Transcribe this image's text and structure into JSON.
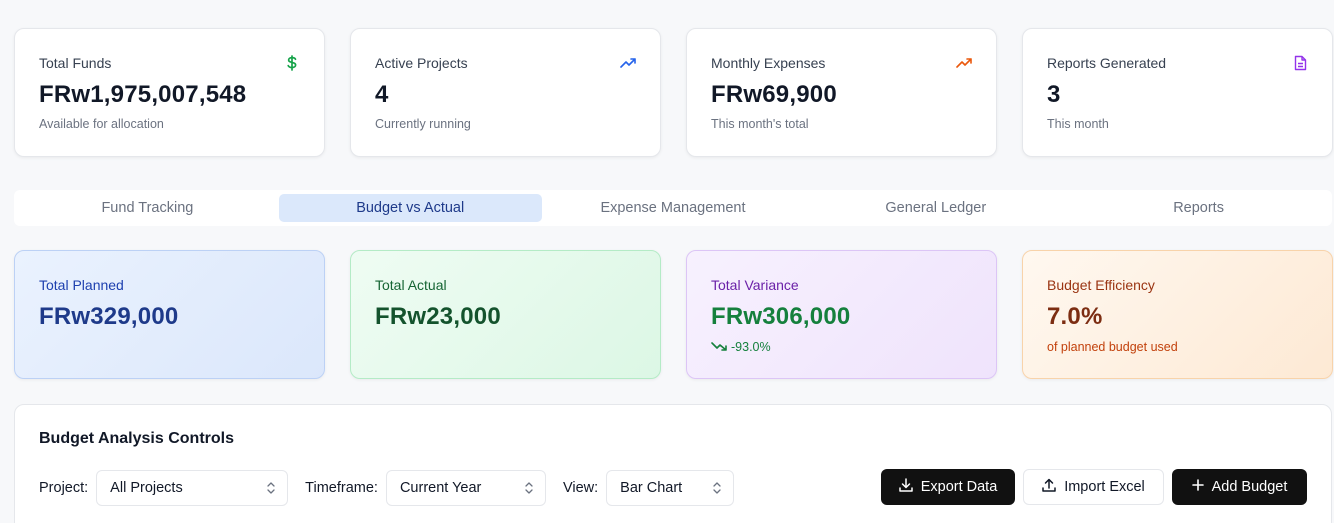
{
  "stats": [
    {
      "title": "Total Funds",
      "value": "FRw1,975,007,548",
      "sub": "Available for allocation",
      "icon": "dollar-icon",
      "icon_color": "#16a34a"
    },
    {
      "title": "Active Projects",
      "value": "4",
      "sub": "Currently running",
      "icon": "trending-up-icon",
      "icon_color": "#2563eb"
    },
    {
      "title": "Monthly Expenses",
      "value": "FRw69,900",
      "sub": "This month's total",
      "icon": "trending-up-icon",
      "icon_color": "#ea580c"
    },
    {
      "title": "Reports Generated",
      "value": "3",
      "sub": "This month",
      "icon": "file-text-icon",
      "icon_color": "#9333ea"
    }
  ],
  "tabs": [
    {
      "label": "Fund Tracking",
      "active": false
    },
    {
      "label": "Budget vs Actual",
      "active": true
    },
    {
      "label": "Expense Management",
      "active": false
    },
    {
      "label": "General Ledger",
      "active": false
    },
    {
      "label": "Reports",
      "active": false
    }
  ],
  "summary": [
    {
      "title": "Total Planned",
      "value": "FRw329,000"
    },
    {
      "title": "Total Actual",
      "value": "FRw23,000"
    },
    {
      "title": "Total Variance",
      "value": "FRw306,000",
      "sub": "-93.0%",
      "icon": "trending-down-icon"
    },
    {
      "title": "Budget Efficiency",
      "value": "7.0%",
      "sub": "of planned budget used"
    }
  ],
  "controls": {
    "heading": "Budget Analysis Controls",
    "project_label": "Project:",
    "project_value": "All Projects",
    "timeframe_label": "Timeframe:",
    "timeframe_value": "Current Year",
    "view_label": "View:",
    "view_value": "Bar Chart",
    "export_label": "Export Data",
    "import_label": "Import Excel",
    "add_label": "Add Budget"
  }
}
